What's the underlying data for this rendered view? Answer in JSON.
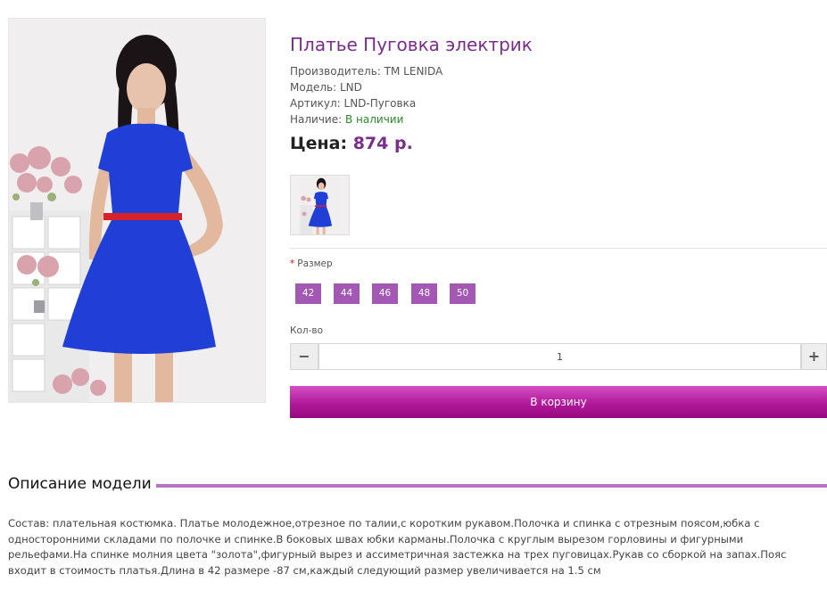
{
  "product": {
    "title": "Платье Пуговка электрик",
    "manufacturer_label": "Производитель:",
    "manufacturer": "TM LENIDA",
    "model_label": "Модель:",
    "model": "LND",
    "sku_label": "Артикул:",
    "sku": "LND-Пуговка",
    "availability_label": "Наличие:",
    "availability": "В наличии",
    "price_label": "Цена:",
    "price": "874 р."
  },
  "options": {
    "required_mark": "*",
    "size_label": "Размер",
    "sizes": [
      "42",
      "44",
      "46",
      "48",
      "50"
    ],
    "qty_label": "Кол-во",
    "qty_minus": "−",
    "qty_value": "1",
    "qty_plus": "+"
  },
  "cart_button": "В корзину",
  "description": {
    "title": "Описание модели",
    "text": "Состав: плательная костюмка. Платье молодежное,отрезное по талии,с коротким рукавом.Полочка и спинка с отрезным поясом,юбка с односторонними складами по полочке и спинке.В боковых швах юбки карманы.Полочка с круглым вырезом горловины и фигурными рельефами.На спинке молния цвета \"золота\",фигурный вырез и ассиметричная застежка на трех пуговицах.Рукав со сборкой на запах.Пояс входит в стоимость платья.Длина в 42 размере -87 см,каждый следующий размер увеличивается на 1.5 см"
  },
  "colors": {
    "accent": "#7b2d8f",
    "size_button": "#a359b3",
    "cart_button": "#b1199a",
    "in_stock": "#2a8a2a",
    "dress": "#1f3fd6"
  }
}
